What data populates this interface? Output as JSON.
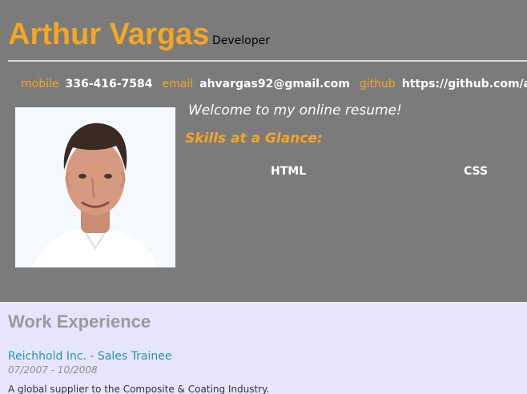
{
  "header": {
    "name": "Arthur Vargas",
    "role": "Developer",
    "contacts": [
      {
        "label": "mobile",
        "value": "336-416-7584"
      },
      {
        "label": "email",
        "value": "ahvargas92@gmail.com"
      },
      {
        "label": "github",
        "value": "https://github.com/ahv"
      }
    ],
    "welcome_message": "Welcome to my online resume!",
    "skills_title": "Skills at a Glance:",
    "skills": [
      "HTML",
      "CSS"
    ],
    "photo_icon": "profile-photo"
  },
  "work": {
    "title": "Work Experience",
    "jobs": [
      {
        "employer_title": "Reichhold Inc. - Sales Trainee",
        "dates": "07/2007 - 10/2008",
        "description": "A global supplier to the Composite & Coating Industry."
      }
    ]
  },
  "colors": {
    "accent": "#f5a623",
    "header_bg": "#7b7b7b",
    "page_bg": "#e7e5fd",
    "link": "#2391b8"
  }
}
